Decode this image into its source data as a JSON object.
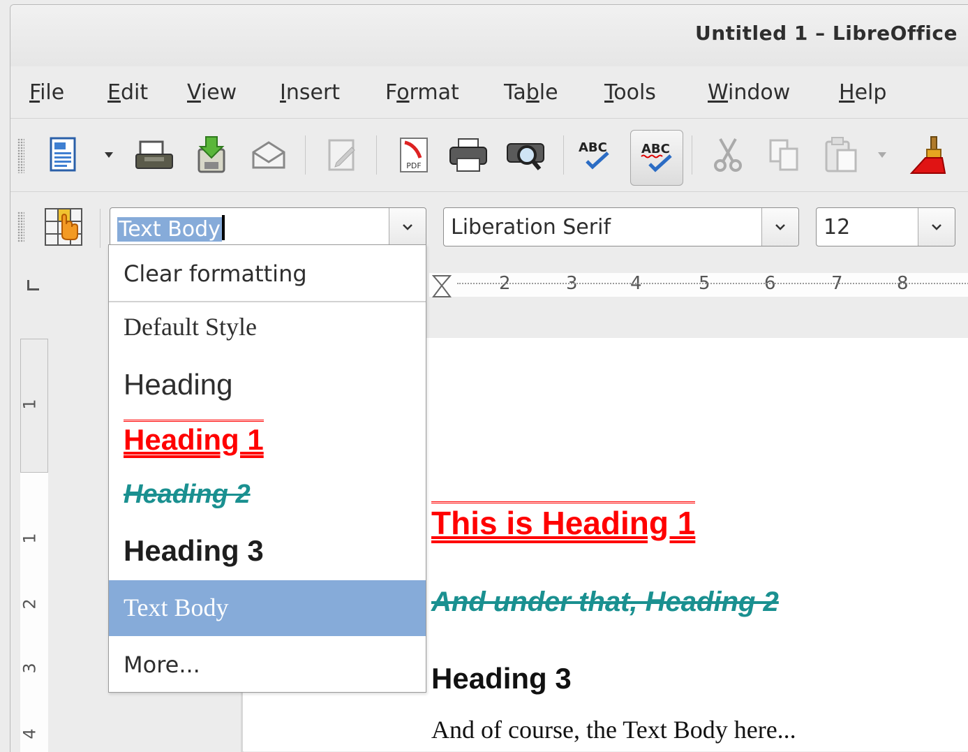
{
  "window": {
    "title": "Untitled 1 – LibreOffice"
  },
  "menu": [
    {
      "label": "File",
      "u": "F",
      "rest": "ile"
    },
    {
      "label": "Edit",
      "u": "E",
      "rest": "dit"
    },
    {
      "label": "View",
      "u": "V",
      "rest": "iew"
    },
    {
      "label": "Insert",
      "u": "I",
      "rest": "nsert"
    },
    {
      "label": "Format",
      "pre": "F",
      "u": "o",
      "rest": "rmat"
    },
    {
      "label": "Table",
      "pre": "Ta",
      "u": "b",
      "rest": "le"
    },
    {
      "label": "Tools",
      "u": "T",
      "rest": "ools"
    },
    {
      "label": "Window",
      "u": "W",
      "rest": "indow"
    },
    {
      "label": "Help",
      "u": "H",
      "rest": "elp"
    }
  ],
  "toolbar": {
    "icons": [
      "new-document-icon",
      "open-icon",
      "save-icon",
      "email-icon",
      "edit-mode-icon",
      "export-pdf-icon",
      "print-icon",
      "print-preview-icon",
      "spelling-icon",
      "autospellcheck-icon",
      "cut-icon",
      "copy-icon",
      "paste-icon",
      "clone-formatting-icon"
    ]
  },
  "formatting": {
    "paragraph_style": "Text Body",
    "font_name": "Liberation Serif",
    "font_size": "12"
  },
  "ruler": {
    "horizontal": [
      "2",
      "3",
      "4",
      "5",
      "6",
      "7",
      "8"
    ],
    "vertical": [
      "1",
      "1",
      "2",
      "3",
      "4"
    ]
  },
  "style_dropdown": {
    "clear": "Clear formatting",
    "default": "Default Style",
    "heading": "Heading",
    "heading1": "Heading 1",
    "heading2": "Heading 2",
    "heading3": "Heading 3",
    "text_body": "Text Body",
    "more": "More..."
  },
  "document": {
    "heading1": "This is Heading 1",
    "heading2": "And under that, Heading 2",
    "heading3": "Heading 3",
    "body": "And of course, the Text Body here..."
  },
  "colors": {
    "heading1": "#ff0000",
    "heading2": "#1a9090",
    "selection": "#86abd9"
  }
}
